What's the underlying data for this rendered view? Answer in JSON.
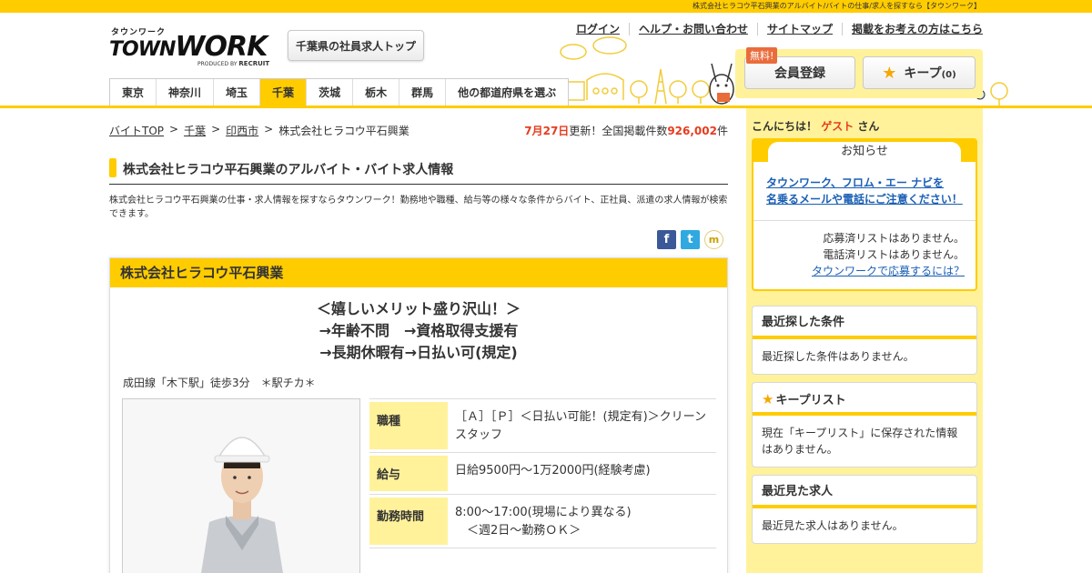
{
  "top_strip": "株式会社ヒラコウ平石興業のアルバイト/バイトの仕事/求人を探すなら【タウンワーク】",
  "logo": {
    "kana": "タウンワーク",
    "word_town": "TOWN",
    "word_work": "WORK",
    "produced_by": "PRODUCED BY",
    "recruit": "RECRUIT"
  },
  "header": {
    "pref_top_button": "千葉県の社員求人トップ",
    "links": [
      "ログイン",
      "ヘルプ・お問い合わせ",
      "サイトマップ",
      "掲載をお考えの方はこちら"
    ],
    "free_tag": "無料!",
    "register_button": "会員登録",
    "keep_button": "キープ",
    "keep_count": "(0)"
  },
  "nav": [
    "東京",
    "神奈川",
    "埼玉",
    "千葉",
    "茨城",
    "栃木",
    "群馬",
    "他の都道府県を選ぶ"
  ],
  "breadcrumb": [
    "バイトTOP",
    "千葉",
    "印西市",
    "株式会社ヒラコウ平石興業"
  ],
  "update": {
    "date": "7月27日",
    "text1": "更新！全国掲載件数",
    "count": "926,002",
    "unit": "件"
  },
  "page": {
    "title": "株式会社ヒラコウ平石興業のアルバイト・バイト求人情報",
    "description": "株式会社ヒラコウ平石興業の仕事・求人情報を探すならタウンワーク！勤務地や職種、給与等の様々な条件からバイト、正社員、派遣の求人情報が検索できます。"
  },
  "card": {
    "company": "株式会社ヒラコウ平石興業",
    "catch_lines": [
      "＜嬉しいメリット盛り沢山！＞",
      "→年齢不問　→資格取得支援有",
      "→長期休暇有→日払い可(規定)"
    ],
    "access": "成田線「木下駅」徒歩3分　＊駅チカ＊",
    "info": [
      {
        "label": "職種",
        "value": "［Ａ］［Ｐ］＜日払い可能！(規定有)＞クリーンスタッフ"
      },
      {
        "label": "給与",
        "value": "日給9500円～1万2000円(経験考慮)"
      },
      {
        "label": "勤務時間",
        "value": "8:00～17:00(現場により異なる)\n　＜週2日～勤務ＯＫ＞"
      }
    ]
  },
  "side": {
    "greet_prefix": "こんにちは！",
    "greet_name": "ゲスト",
    "greet_suffix": "さん",
    "notice_title": "お知らせ",
    "notice_link_1": "タウンワーク、フロム・エー ナビを",
    "notice_link_2": "名乗るメールや電話にご注意ください！",
    "applied_list": "応募済リストはありません。",
    "phoned_list": "電話済リストはありません。",
    "how_to_apply": "タウンワークで応募するには？",
    "recent_conditions_title": "最近探した条件",
    "recent_conditions_body": "最近探した条件はありません。",
    "keep_list_title": "キープリスト",
    "keep_list_body": "現在「キープリスト」に保存された情報はありません。",
    "recent_jobs_title": "最近見た求人",
    "recent_jobs_body": "最近見た求人はありません。"
  },
  "colors": {
    "brand_yellow": "#ffcc00",
    "pale_yellow": "#fff29a",
    "accent_red": "#e63c1e",
    "link_blue": "#1a5fb4"
  }
}
